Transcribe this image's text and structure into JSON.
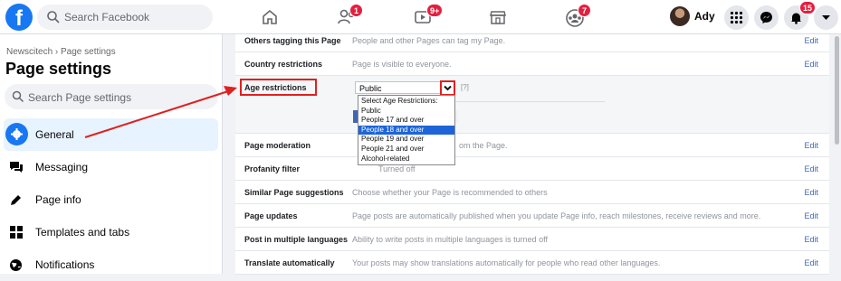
{
  "topbar": {
    "logo": "f",
    "search_placeholder": "Search Facebook",
    "nav": [
      {
        "icon": "home-icon",
        "badge": ""
      },
      {
        "icon": "friends-icon",
        "badge": "1"
      },
      {
        "icon": "watch-icon",
        "badge": "9+"
      },
      {
        "icon": "marketplace-icon",
        "badge": ""
      },
      {
        "icon": "groups-icon",
        "badge": "7"
      }
    ],
    "profile_name": "Ady",
    "notifications_badge": "15"
  },
  "sidebar": {
    "breadcrumb": "Newscitech › Page settings",
    "title": "Page settings",
    "search_placeholder": "Search Page settings",
    "items": [
      {
        "label": "General",
        "icon": "gear-icon",
        "active": true
      },
      {
        "label": "Messaging",
        "icon": "chat-icon",
        "active": false
      },
      {
        "label": "Page info",
        "icon": "pencil-icon",
        "active": false
      },
      {
        "label": "Templates and tabs",
        "icon": "grid-icon",
        "active": false
      },
      {
        "label": "Notifications",
        "icon": "globe-icon",
        "active": false
      }
    ]
  },
  "settings": {
    "rows": [
      {
        "key": "Others tagging this Page",
        "value": "People and other Pages can tag my Page.",
        "edit": "Edit"
      },
      {
        "key": "Country restrictions",
        "value": "Page is visible to everyone.",
        "edit": "Edit"
      },
      {
        "key": "Age restrictions",
        "value": "",
        "edit": ""
      },
      {
        "key": "Page moderation",
        "value": "om the Page.",
        "edit": "Edit"
      },
      {
        "key": "Profanity filter",
        "value": "Turned off",
        "edit": "Edit"
      },
      {
        "key": "Similar Page suggestions",
        "value": "Choose whether your Page is recommended to others",
        "edit": "Edit"
      },
      {
        "key": "Page updates",
        "value": "Page posts are automatically published when you update Page info, reach milestones, receive reviews and more.",
        "edit": "Edit"
      },
      {
        "key": "Post in multiple languages",
        "value": "Ability to write posts in multiple languages is turned off",
        "edit": "Edit"
      },
      {
        "key": "Translate automatically",
        "value": "Your posts may show translations automatically for people who read other languages.",
        "edit": "Edit"
      }
    ],
    "age_select_value": "Public",
    "help_marker": "[?]",
    "age_options": [
      {
        "label": "Select Age Restrictions:",
        "selected": false
      },
      {
        "label": "Public",
        "selected": false
      },
      {
        "label": "People 17 and over",
        "selected": false
      },
      {
        "label": "People 18 and over",
        "selected": true
      },
      {
        "label": "People 19 and over",
        "selected": false
      },
      {
        "label": "People 21 and over",
        "selected": false
      },
      {
        "label": "Alcohol-related",
        "selected": false
      }
    ]
  },
  "colors": {
    "brand": "#1877f2",
    "annotation": "#e02020",
    "badge": "#e41e3f"
  }
}
